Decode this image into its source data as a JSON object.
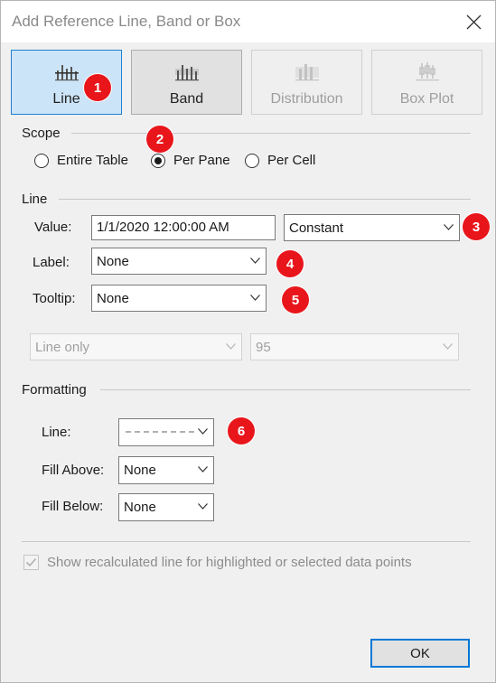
{
  "dialog": {
    "title": "Add Reference Line, Band or Box"
  },
  "type_buttons": [
    {
      "label": "Line",
      "state": "selected",
      "icon": "line-chart-icon"
    },
    {
      "label": "Band",
      "state": "normal",
      "icon": "band-chart-icon"
    },
    {
      "label": "Distribution",
      "state": "disabled",
      "icon": "distribution-chart-icon"
    },
    {
      "label": "Box Plot",
      "state": "disabled",
      "icon": "box-plot-icon"
    }
  ],
  "badges": [
    "1",
    "2",
    "3",
    "4",
    "5",
    "6"
  ],
  "scope": {
    "heading": "Scope",
    "options": [
      "Entire Table",
      "Per Pane",
      "Per Cell"
    ],
    "selected": "Per Pane"
  },
  "line": {
    "heading": "Line",
    "value_label": "Value:",
    "value": "1/1/2020 12:00:00 AM",
    "value_type": "Constant",
    "label_label": "Label:",
    "label_value": "None",
    "tooltip_label": "Tooltip:",
    "tooltip_value": "None",
    "conf_mode": "Line only",
    "conf_level": "95"
  },
  "formatting": {
    "heading": "Formatting",
    "line_label": "Line:",
    "fill_above_label": "Fill Above:",
    "fill_above_value": "None",
    "fill_below_label": "Fill Below:",
    "fill_below_value": "None"
  },
  "recalc": {
    "label": "Show recalculated line for highlighted or selected data points",
    "checked": true,
    "enabled": false
  },
  "footer": {
    "ok_label": "OK"
  },
  "colors": {
    "accent": "#0078d7",
    "selected_bg": "#cce4f7",
    "badge": "#e8161b"
  }
}
